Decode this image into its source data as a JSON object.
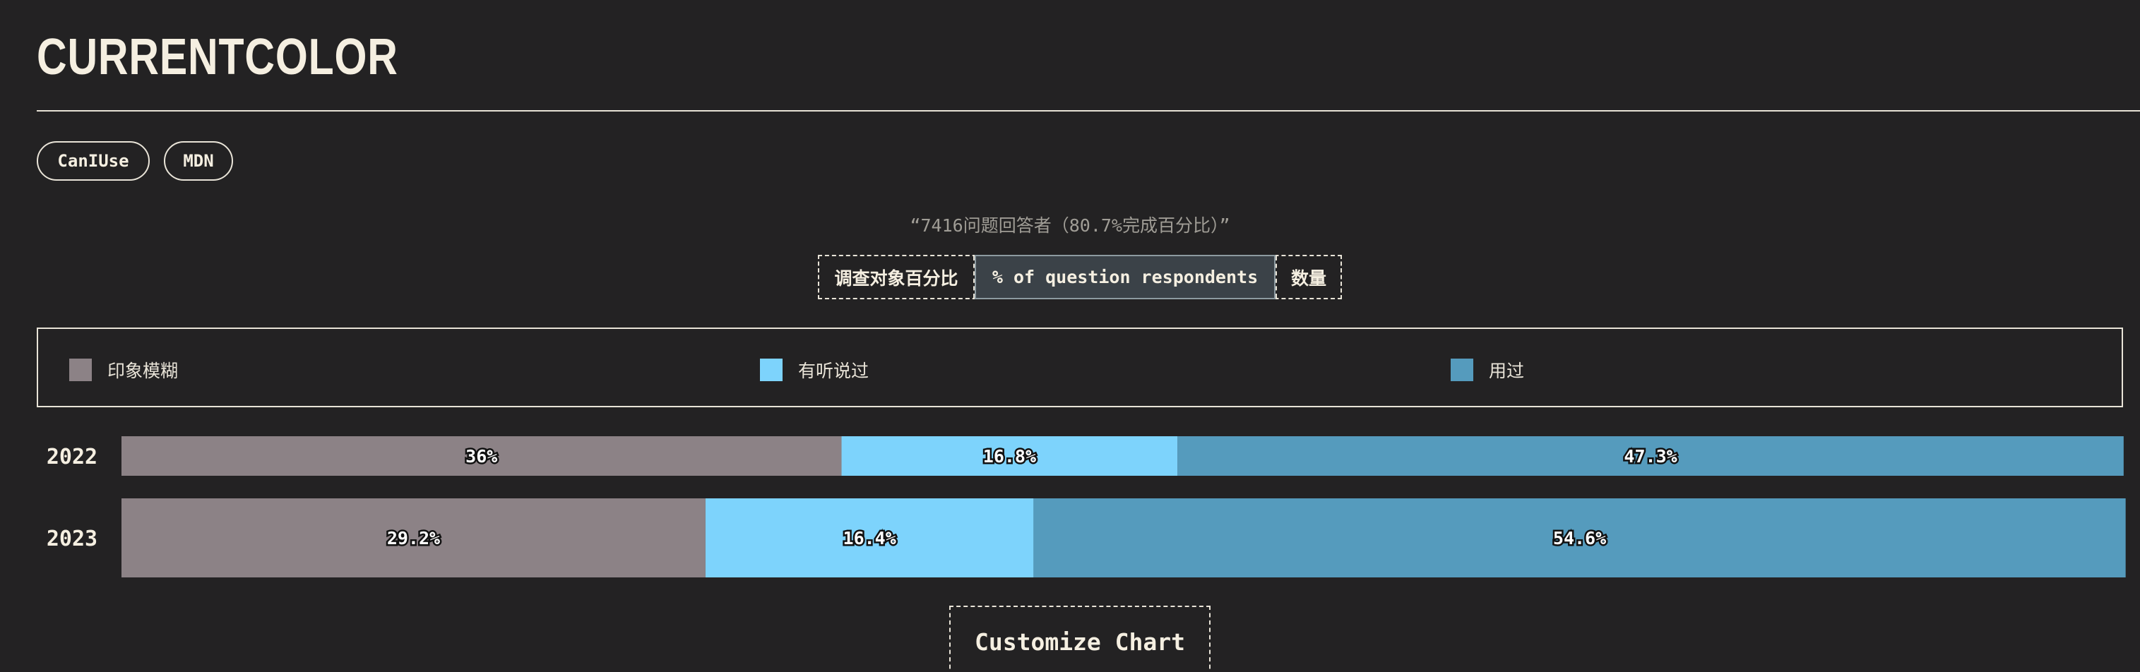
{
  "page": {
    "title": "CURRENTCOLOR",
    "links": [
      {
        "label": "CanIUse"
      },
      {
        "label": "MDN"
      }
    ],
    "respondents_note": "“7416问题回答者（80.7%完成百分比）”",
    "mode_toggle": {
      "options": [
        "调查对象百分比",
        "% of question respondents",
        "数量"
      ],
      "selected": "% of question respondents"
    },
    "customize_label": "Customize Chart"
  },
  "chart_data": {
    "type": "bar",
    "orientation": "horizontal",
    "stacked": true,
    "categories": [
      "2022",
      "2023"
    ],
    "series": [
      {
        "name": "印象模糊",
        "color": "#8c8286",
        "values": [
          36,
          29.2
        ]
      },
      {
        "name": "有听说过",
        "color": "#7dd3fc",
        "values": [
          16.8,
          16.4
        ]
      },
      {
        "name": "用过",
        "color": "#559bbd",
        "values": [
          47.3,
          54.6
        ]
      }
    ],
    "value_format": "percent",
    "xlim": [
      0,
      100
    ],
    "legend_position": "top",
    "grid": false
  }
}
